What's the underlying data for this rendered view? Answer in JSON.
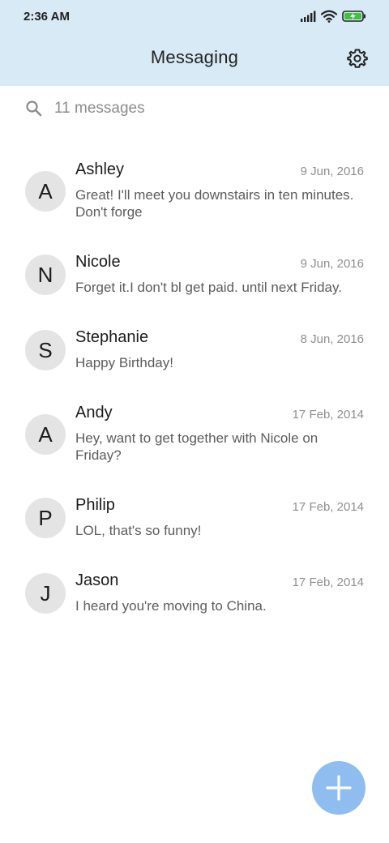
{
  "status_bar": {
    "time": "2:36 AM",
    "icons": [
      "signal-icon",
      "wifi-icon",
      "battery-charging-icon"
    ]
  },
  "header": {
    "title": "Messaging",
    "settings_icon": "gear-icon"
  },
  "search": {
    "icon": "search-icon",
    "text": "11 messages"
  },
  "conversations": [
    {
      "initial": "A",
      "name": "Ashley",
      "date": "9 Jun, 2016",
      "preview": "Great! I'll meet you downstairs in ten minutes. Don't forge"
    },
    {
      "initial": "N",
      "name": "Nicole",
      "date": "9 Jun, 2016",
      "preview": "Forget it.I don't bl get paid. until next Friday."
    },
    {
      "initial": "S",
      "name": "Stephanie",
      "date": "8 Jun, 2016",
      "preview": "Happy Birthday!"
    },
    {
      "initial": "A",
      "name": "Andy",
      "date": "17 Feb, 2014",
      "preview": "Hey, want to get together with Nicole on Friday?"
    },
    {
      "initial": "P",
      "name": "Philip",
      "date": "17 Feb, 2014",
      "preview": "LOL, that's so funny!"
    },
    {
      "initial": "J",
      "name": "Jason",
      "date": "17 Feb, 2014",
      "preview": "I heard you're moving to China."
    }
  ],
  "fab": {
    "icon": "plus-icon",
    "color": "#8fbdf0"
  },
  "colors": {
    "header_bg": "#d8eaf5",
    "avatar_bg": "#e4e4e4",
    "battery_green": "#3ec23e"
  }
}
